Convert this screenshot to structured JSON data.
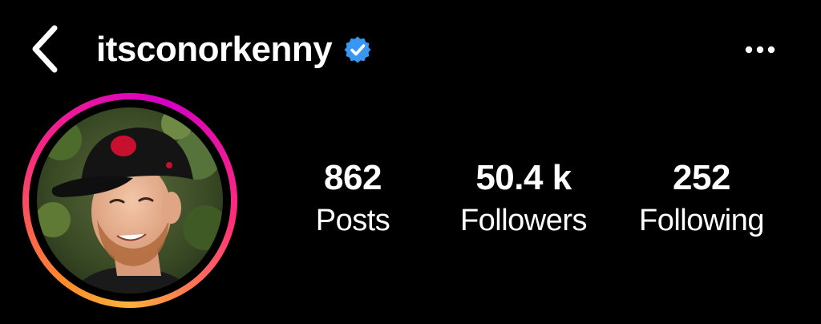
{
  "header": {
    "username": "itsconorkenny",
    "back_icon": "chevron-left-icon",
    "verified_icon": "verified-badge-icon",
    "more_icon": "more-horizontal-icon"
  },
  "colors": {
    "background": "#000000",
    "text": "#ffffff",
    "verified": "#3897f0",
    "ring_gradient": [
      "#fbb03b",
      "#ff8a2a",
      "#f72585",
      "#d300c5"
    ]
  },
  "stats": {
    "posts": {
      "value": "862",
      "label": "Posts"
    },
    "followers": {
      "value": "50.4 k",
      "label": "Followers"
    },
    "following": {
      "value": "252",
      "label": "Following"
    }
  }
}
